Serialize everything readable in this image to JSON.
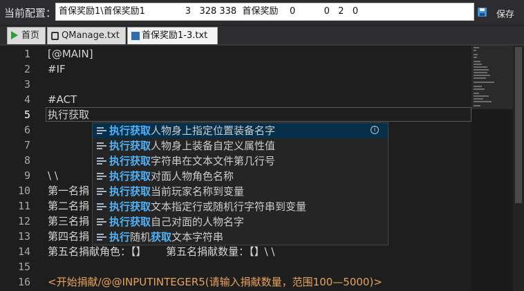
{
  "config": {
    "label": "当前配置：",
    "value": "首保奖励1\\首保奖励1              3   328 338  首保奖励    0          0   2   0"
  },
  "save_label": "保存",
  "tabs": [
    {
      "label": "首页",
      "icon": "play-icon"
    },
    {
      "label": "QManage.txt",
      "icon": "file-icon"
    },
    {
      "label": "首保奖励1-3.txt",
      "icon": "save-icon"
    }
  ],
  "editor": {
    "current_line": 5,
    "lines": [
      {
        "n": "1",
        "text": "[@MAIN]"
      },
      {
        "n": "2",
        "text": "#IF"
      },
      {
        "n": "3",
        "text": ""
      },
      {
        "n": "4",
        "text": "#ACT"
      },
      {
        "n": "5",
        "text": "执行获取"
      },
      {
        "n": "6",
        "text": ""
      },
      {
        "n": "7",
        "text": ""
      },
      {
        "n": "8",
        "text": ""
      },
      {
        "n": "9",
        "text": "\\ \\"
      },
      {
        "n": "10",
        "text": "第一名捐"
      },
      {
        "n": "11",
        "text": "第二名捐"
      },
      {
        "n": "12",
        "text": "第三名捐"
      },
      {
        "n": "13",
        "text": "第四名捐"
      },
      {
        "n": "14",
        "text": "第五名捐献角色：【】      第五名捐献数量：【】\\ \\"
      },
      {
        "n": "15",
        "text": ""
      },
      {
        "n": "16",
        "text": "<开始捐献/@@INPUTINTEGER5(请输入捐献数量，范围100—5000)>"
      }
    ]
  },
  "autocomplete": {
    "items": [
      {
        "hl": "执行获取",
        "rest": "人物身上指定位置装备名字",
        "selected": true
      },
      {
        "hl": "执行获取",
        "rest": "人物身上装备自定义属性值"
      },
      {
        "hl": "执行获取",
        "rest": "字符串在文本文件第几行号"
      },
      {
        "hl": "执行获取",
        "rest": "对面人物角色名称"
      },
      {
        "hl": "执行获取",
        "rest": "当前玩家名称到变量"
      },
      {
        "hl": "执行获取",
        "rest": "文本指定行或随机行字符串到变量"
      },
      {
        "hl": "执行获取",
        "rest": "自己对面的人物名字"
      },
      {
        "hl": "执行",
        "mid": "随机",
        "hl2": "获取",
        "rest": "文本字符串"
      }
    ]
  },
  "colors": {
    "background": "#1e1e1e",
    "keyword": "#4fb1f6",
    "string_line": "#e8a35a",
    "selection": "#062f4a"
  }
}
